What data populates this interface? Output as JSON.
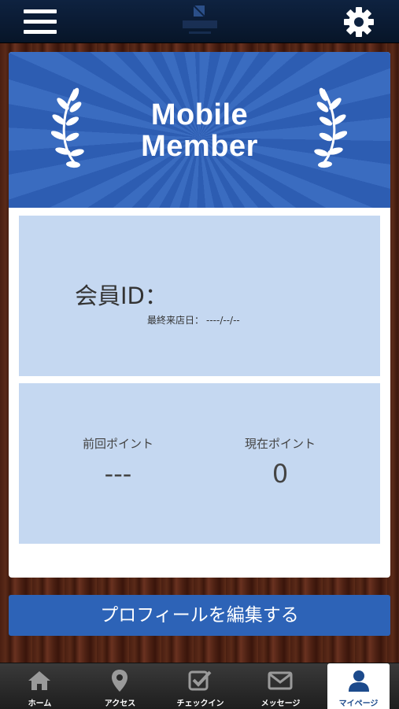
{
  "header": {
    "menu_icon": "hamburger-menu-icon",
    "settings_icon": "gear-icon",
    "logo": "store-logo"
  },
  "banner": {
    "line1": "Mobile",
    "line2": "Member"
  },
  "member": {
    "id_label": "会員ID：",
    "last_visit_label": "最終来店日：",
    "last_visit_value": "----/--/--"
  },
  "points": {
    "previous_label": "前回ポイント",
    "previous_value": "---",
    "current_label": "現在ポイント",
    "current_value": "0"
  },
  "edit_profile_label": "プロフィールを編集する",
  "nav": {
    "items": [
      {
        "label": "ホーム",
        "icon": "home-icon"
      },
      {
        "label": "アクセス",
        "icon": "map-pin-icon"
      },
      {
        "label": "チェックイン",
        "icon": "checkbox-icon"
      },
      {
        "label": "メッセージ",
        "icon": "envelope-icon"
      },
      {
        "label": "マイページ",
        "icon": "user-icon",
        "active": true
      }
    ]
  },
  "colors": {
    "header": "#0e2240",
    "banner": "#2d5db2",
    "panel": "#c5d8f1",
    "button": "#2d63b7",
    "nav_active_text": "#1c4a8c"
  }
}
